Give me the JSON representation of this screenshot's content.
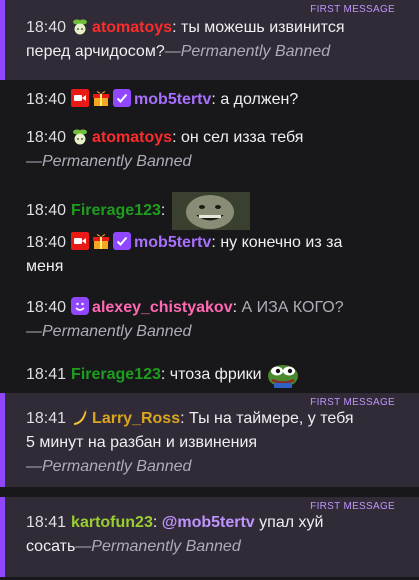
{
  "first_message_label": "FIRST MESSAGE",
  "separator": ":",
  "messages": [
    {
      "time": "18:40",
      "user": "atomatoys",
      "user_color": "#ff2b2b",
      "text_line1": "ты можешь извинится",
      "text_line2": "перед арчидосом?",
      "suffix": "—Permanently Banned"
    },
    {
      "time": "18:40",
      "user": "mob5tertv",
      "user_color": "#a970ff",
      "text": "а должен?"
    },
    {
      "time": "18:40",
      "user": "atomatoys",
      "user_color": "#ff2b2b",
      "text": "он сел изза тебя",
      "suffix": "—Permanently Banned"
    },
    {
      "time": "18:40",
      "user": "Firerage123",
      "user_color": "#1e9e1e",
      "text": ""
    },
    {
      "time": "18:40",
      "user": "mob5tertv",
      "user_color": "#a970ff",
      "text_line1": "ну конечно из за",
      "text_line2": "меня"
    },
    {
      "time": "18:40",
      "user": "alexey_chistyakov",
      "user_color": "#ff69b4",
      "text": "А ИЗА КОГО?",
      "suffix": "—Permanently Banned"
    },
    {
      "time": "18:41",
      "user": "Firerage123",
      "user_color": "#1e9e1e",
      "text": "чтоза фрики"
    },
    {
      "time": "18:41",
      "user": "Larry_Ross",
      "user_color": "#daa520",
      "text_line1": "Ты на таймере, у тебя",
      "text_line2": "5 минут на разбан и извинения",
      "suffix": "—Permanently Banned"
    },
    {
      "time": "18:41",
      "user": "kartofun23",
      "user_color": "#9acd32",
      "mention": "@mob5tertv",
      "text_line1": "упал хуй",
      "text_line2": "сосать",
      "suffix": "—Permanently Banned"
    }
  ]
}
